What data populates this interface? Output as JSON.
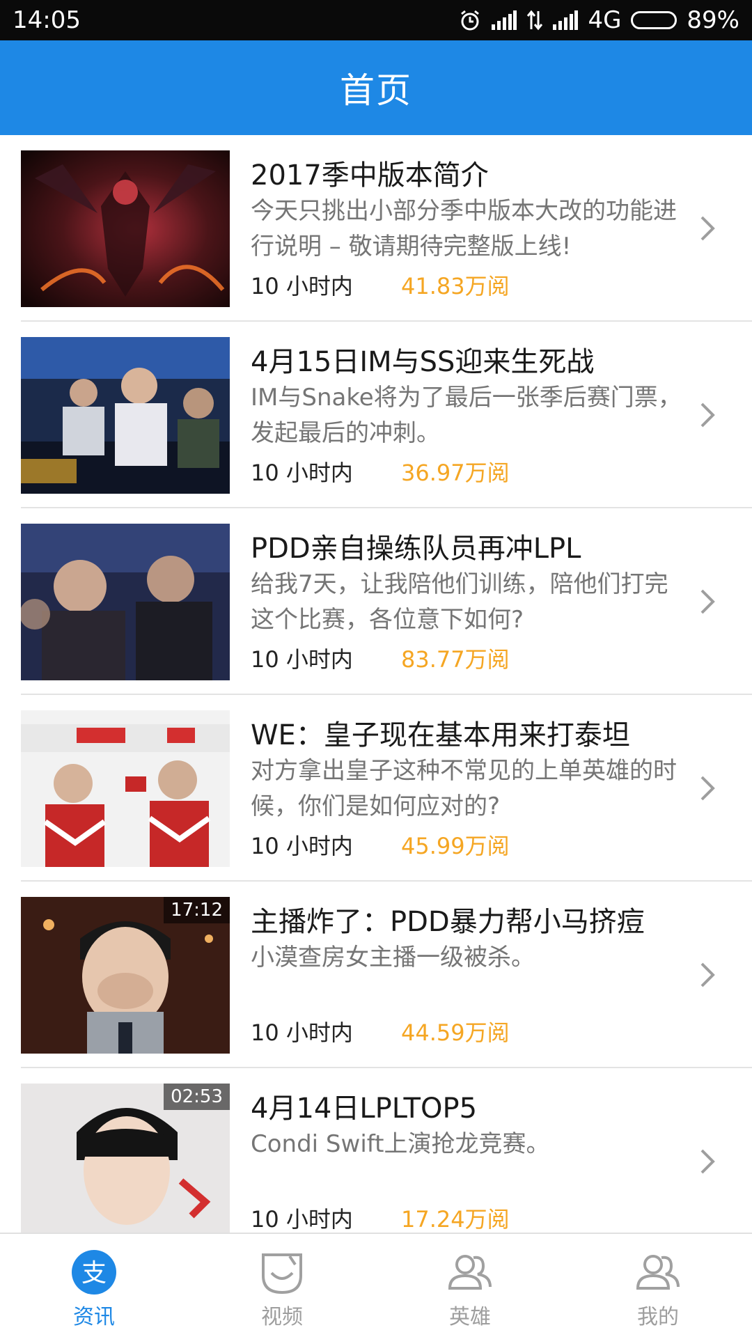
{
  "status_bar": {
    "time": "14:05",
    "network": "4G",
    "battery": "89%",
    "battery_level": 0.89,
    "icons": [
      "alarm-icon",
      "signal-icon",
      "data-transfer-icon",
      "signal-icon",
      "battery-icon"
    ]
  },
  "header": {
    "title": "首页"
  },
  "colors": {
    "accent": "#1e88e5",
    "views": "#f5a623",
    "title": "#1a1a1a",
    "summary": "#757575"
  },
  "news": [
    {
      "title": "2017季中版本简介",
      "summary": "今天只挑出小部分季中版本大改的功能进行说明 – 敬请期待完整版上线!",
      "time": "10 小时内",
      "views": "41.83万阅",
      "duration": ""
    },
    {
      "title": "4月15日IM与SS迎来生死战",
      "summary": "IM与Snake将为了最后一张季后赛门票，发起最后的冲刺。",
      "time": "10 小时内",
      "views": "36.97万阅",
      "duration": ""
    },
    {
      "title": "PDD亲自操练队员再冲LPL",
      "summary": "给我7天，让我陪他们训练，陪他们打完这个比赛，各位意下如何?",
      "time": "10 小时内",
      "views": "83.77万阅",
      "duration": ""
    },
    {
      "title": "WE：皇子现在基本用来打泰坦",
      "summary": "对方拿出皇子这种不常见的上单英雄的时候，你们是如何应对的?",
      "time": "10 小时内",
      "views": "45.99万阅",
      "duration": ""
    },
    {
      "title": "主播炸了：PDD暴力帮小马挤痘",
      "summary": "小漠查房女主播一级被杀。",
      "time": "10 小时内",
      "views": "44.59万阅",
      "duration": "17:12"
    },
    {
      "title": "4月14日LPLTOP5",
      "summary": "Condi Swift上演抢龙竞赛。",
      "time": "10 小时内",
      "views": "17.24万阅",
      "duration": "02:53"
    }
  ],
  "bottom_nav": [
    {
      "label": "资讯",
      "icon": "news-icon",
      "active": true
    },
    {
      "label": "视频",
      "icon": "video-icon",
      "active": false
    },
    {
      "label": "英雄",
      "icon": "heroes-icon",
      "active": false
    },
    {
      "label": "我的",
      "icon": "profile-icon",
      "active": false
    }
  ],
  "news_icon_glyph": "支"
}
